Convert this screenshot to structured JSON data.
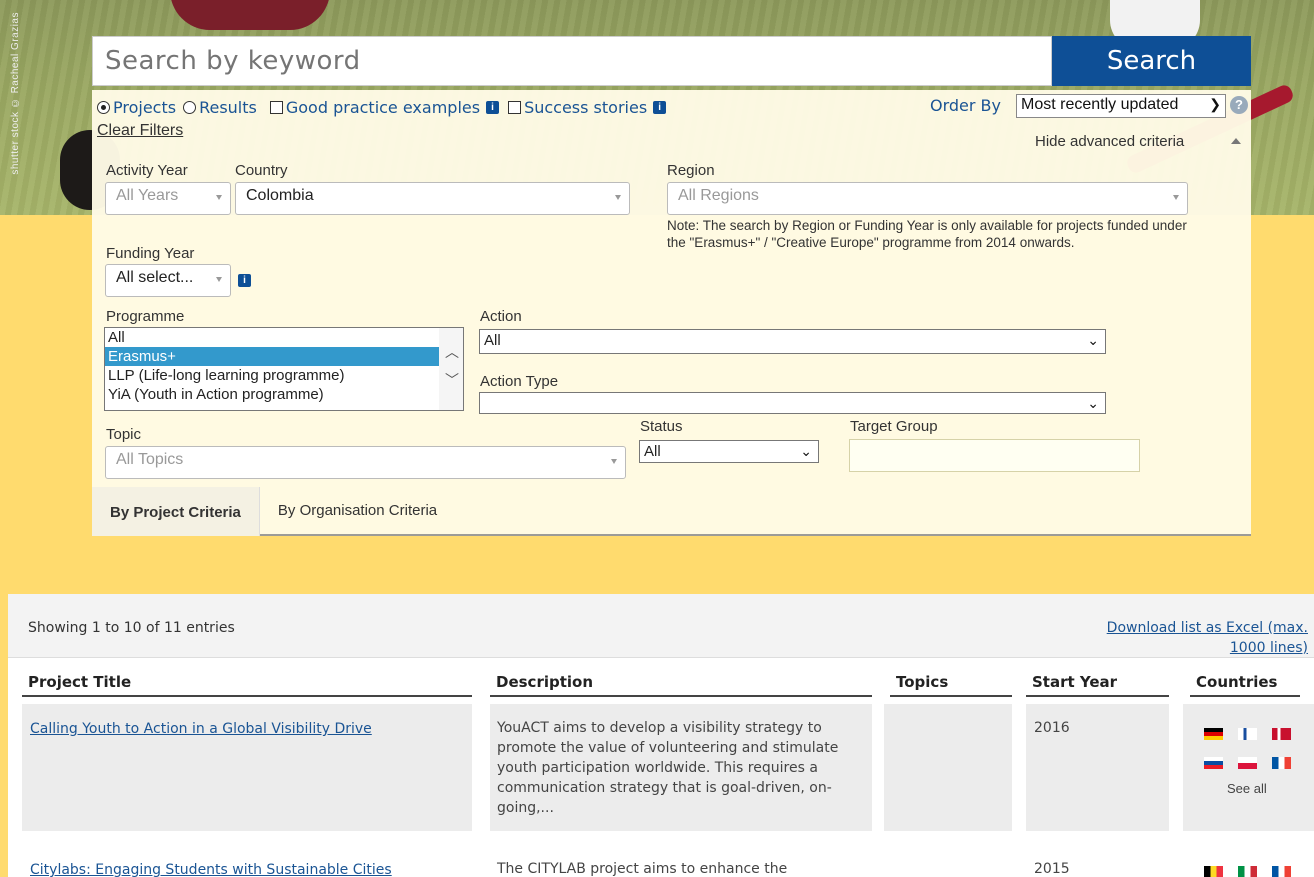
{
  "hero": {
    "credit": "shutter stock © Racheal Grazias"
  },
  "search": {
    "placeholder": "Search by keyword",
    "button_label": "Search"
  },
  "filters": {
    "radio_projects": "Projects",
    "radio_results": "Results",
    "check_good_practice": "Good practice examples",
    "check_success": "Success stories",
    "clear_filters": "Clear Filters",
    "order_by_label": "Order By",
    "order_by_value": "Most recently updated",
    "hide_advanced": "Hide advanced criteria",
    "activity_year_label": "Activity Year",
    "activity_year_value": "All Years",
    "country_label": "Country",
    "country_value": "Colombia",
    "region_label": "Region",
    "region_value": "All Regions",
    "region_note": "Note: The search by Region or Funding Year is only available for projects funded under the \"Erasmus+\" / \"Creative Europe\" programme from 2014 onwards.",
    "funding_year_label": "Funding Year",
    "funding_year_value": "All select...",
    "programme_label": "Programme",
    "programme_options": [
      "All",
      "Erasmus+",
      "LLP (Life-long learning programme)",
      "YiA (Youth in Action programme)"
    ],
    "action_label": "Action",
    "action_value": "All",
    "action_type_label": "Action Type",
    "action_type_value": "",
    "topic_label": "Topic",
    "topic_value": "All Topics",
    "status_label": "Status",
    "status_value": "All",
    "target_group_label": "Target Group",
    "tab_project": "By Project Criteria",
    "tab_organisation": "By Organisation Criteria"
  },
  "results": {
    "showing": "Showing 1 to 10 of 11 entries",
    "download_line1": "Download list as Excel (max.",
    "download_line2": "1000 lines)",
    "columns": [
      "Project Title",
      "Description",
      "Topics",
      "Start Year",
      "Countries"
    ],
    "rows": [
      {
        "title": "Calling Youth to Action in a Global Visibility Drive",
        "description": "YouACT aims to develop a visibility strategy to promote the value of volunteering and stimulate youth participation worldwide. This requires a communication strategy that is goal-driven, on-going,...",
        "start_year": "2016",
        "see_all": "See all"
      },
      {
        "title": "Citylabs: Engaging Students with Sustainable Cities",
        "description": "The CITYLAB project aims to enhance the",
        "start_year": "2015"
      }
    ]
  },
  "colors": {
    "brand_blue": "#0e4f96",
    "panel_bg": "#fffbe6",
    "page_bg": "#ffdb6e",
    "selected_item": "#3399cc",
    "link": "#1a5494"
  }
}
